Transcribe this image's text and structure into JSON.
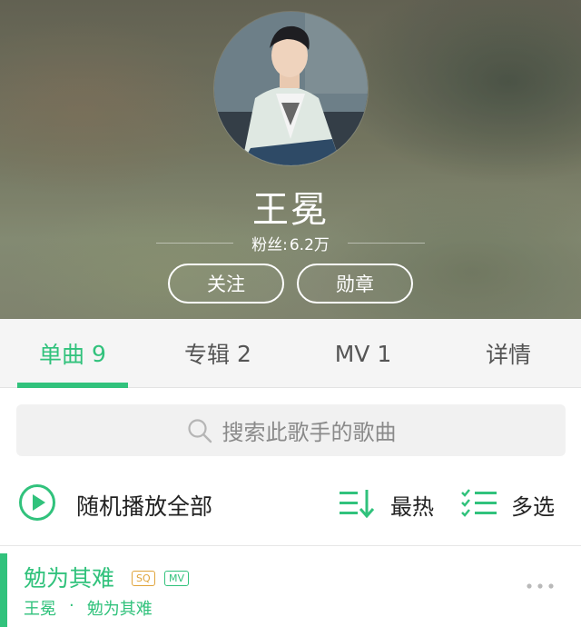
{
  "artist": {
    "name": "王冕",
    "fans_label": "粉丝:",
    "fans_count": "6.2万"
  },
  "header_buttons": {
    "follow": "关注",
    "badge": "勋章"
  },
  "tabs": [
    {
      "label": "单曲",
      "count": "9",
      "active": true
    },
    {
      "label": "专辑",
      "count": "2",
      "active": false
    },
    {
      "label": "MV",
      "count": "1",
      "active": false
    },
    {
      "label": "详情",
      "count": "",
      "active": false
    }
  ],
  "search": {
    "placeholder": "搜索此歌手的歌曲"
  },
  "actions": {
    "shuffle_all": "随机播放全部",
    "sort_hot": "最热",
    "multi_select": "多选"
  },
  "songs": [
    {
      "title": "勉为其难",
      "tags": [
        "SQ",
        "MV"
      ],
      "artist": "王冕",
      "separator": "·",
      "album": "勉为其难"
    }
  ],
  "icons": {
    "search": "search-icon",
    "play": "play-circle-icon",
    "sort": "sort-icon",
    "multi": "multi-select-icon",
    "more": "more-icon"
  },
  "colors": {
    "accent": "#31c27c",
    "sq_tag": "#e0a43a"
  }
}
